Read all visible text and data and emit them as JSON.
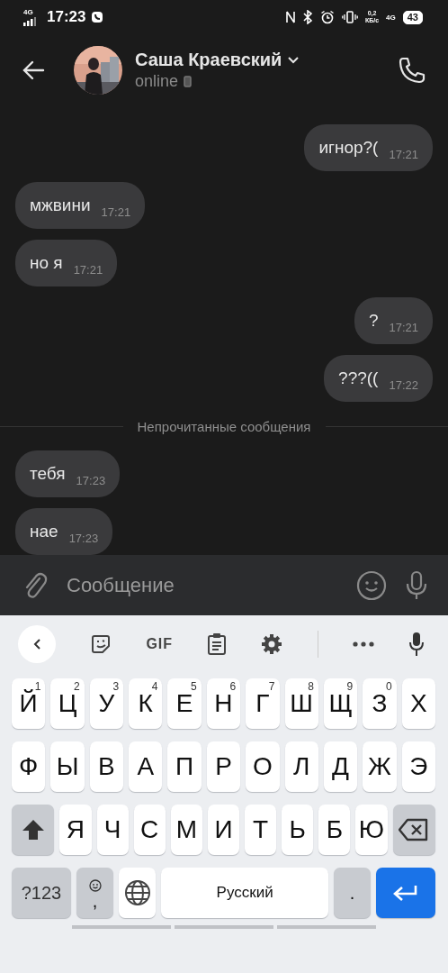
{
  "status_bar": {
    "network": "4G",
    "time": "17:23",
    "speed": "0,2",
    "speed_unit": "КБ/с",
    "network_right": "4G",
    "battery": "43"
  },
  "header": {
    "name": "Саша Краевский",
    "status": "online"
  },
  "messages": [
    {
      "kind": "outgoing",
      "text": "игнор?(",
      "time": "17:21"
    },
    {
      "kind": "incoming",
      "text": "мжвини",
      "time": "17:21"
    },
    {
      "kind": "incoming",
      "text": "но я",
      "time": "17:21"
    },
    {
      "kind": "outgoing",
      "text": "?",
      "time": "17:21"
    },
    {
      "kind": "outgoing",
      "text": "???((",
      "time": "17:22"
    },
    {
      "kind": "divider",
      "text": "Непрочитанные сообщения"
    },
    {
      "kind": "incoming",
      "text": "тебя",
      "time": "17:23"
    },
    {
      "kind": "incoming",
      "text": "нае",
      "time": "17:23"
    }
  ],
  "composer": {
    "placeholder": "Сообщение"
  },
  "keyboard_toolbar": {
    "gif": "GIF"
  },
  "keyboard": {
    "rows": [
      {
        "keys": [
          {
            "label": "Й",
            "hint": "1"
          },
          {
            "label": "Ц",
            "hint": "2"
          },
          {
            "label": "У",
            "hint": "3"
          },
          {
            "label": "К",
            "hint": "4"
          },
          {
            "label": "Е",
            "hint": "5"
          },
          {
            "label": "Н",
            "hint": "6"
          },
          {
            "label": "Г",
            "hint": "7"
          },
          {
            "label": "Ш",
            "hint": "8"
          },
          {
            "label": "Щ",
            "hint": "9"
          },
          {
            "label": "З",
            "hint": "0"
          },
          {
            "label": "Х"
          }
        ]
      },
      {
        "keys": [
          {
            "label": "Ф"
          },
          {
            "label": "Ы"
          },
          {
            "label": "В"
          },
          {
            "label": "А"
          },
          {
            "label": "П"
          },
          {
            "label": "Р"
          },
          {
            "label": "О"
          },
          {
            "label": "Л"
          },
          {
            "label": "Д"
          },
          {
            "label": "Ж"
          },
          {
            "label": "Э"
          }
        ]
      },
      {
        "keys": [
          {
            "kind": "shift"
          },
          {
            "label": "Я"
          },
          {
            "label": "Ч"
          },
          {
            "label": "С"
          },
          {
            "label": "М"
          },
          {
            "label": "И"
          },
          {
            "label": "Т"
          },
          {
            "label": "Ь"
          },
          {
            "label": "Б"
          },
          {
            "label": "Ю"
          },
          {
            "kind": "backspace"
          }
        ]
      },
      {
        "keys": [
          {
            "kind": "symbols",
            "label": "?123"
          },
          {
            "kind": "emoji",
            "label": ","
          },
          {
            "kind": "globe"
          },
          {
            "kind": "space",
            "label": "Русский"
          },
          {
            "kind": "period",
            "label": "."
          },
          {
            "kind": "enter"
          }
        ]
      }
    ]
  }
}
